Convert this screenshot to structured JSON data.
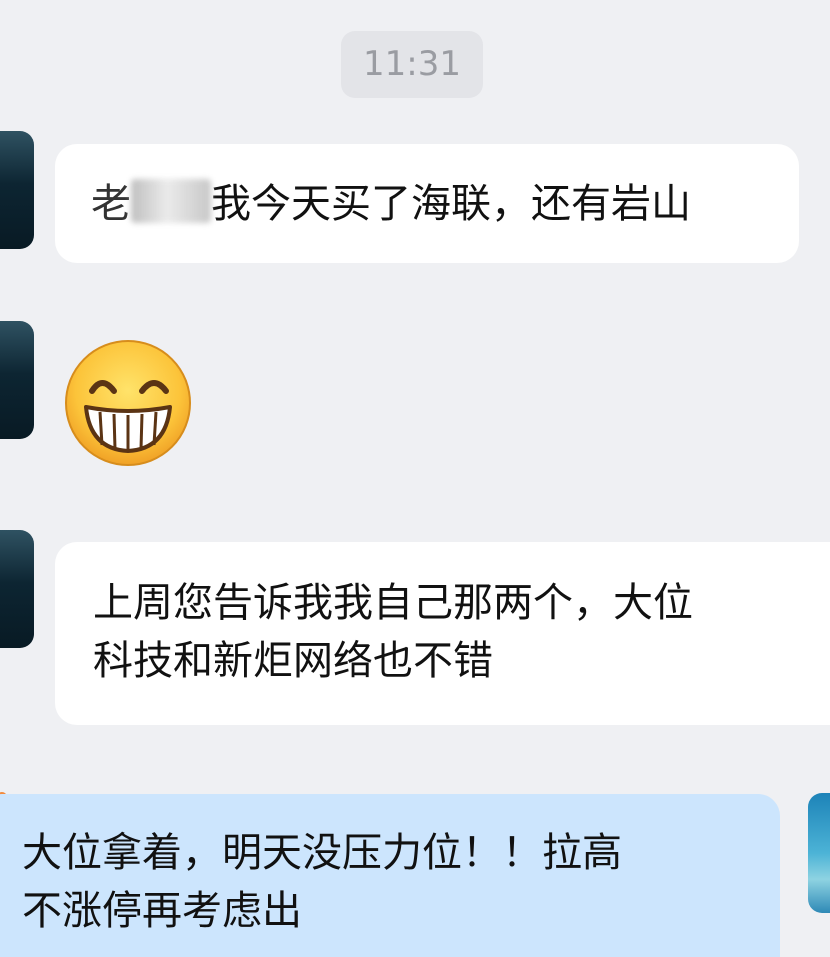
{
  "timestamp": "11:31",
  "messages": [
    {
      "direction": "incoming",
      "redacted_prefix": "老",
      "text": "我今天买了海联，还有岩山"
    },
    {
      "direction": "incoming",
      "emoji": "grinning-face-with-big-eyes"
    },
    {
      "direction": "incoming",
      "line1": "上周您告诉我我自己那两个，大位",
      "line2": "科技和新炬网络也不错"
    },
    {
      "direction": "outgoing",
      "line1": "大位拿着，明天没压力位！！拉高",
      "line2": "不涨停再考虑出"
    }
  ],
  "colors": {
    "background": "#eff0f3",
    "incoming_bubble": "#ffffff",
    "outgoing_bubble": "#cce5fd",
    "timestamp_text": "#9a9ca2",
    "unread_dot": "#f28a3c"
  }
}
